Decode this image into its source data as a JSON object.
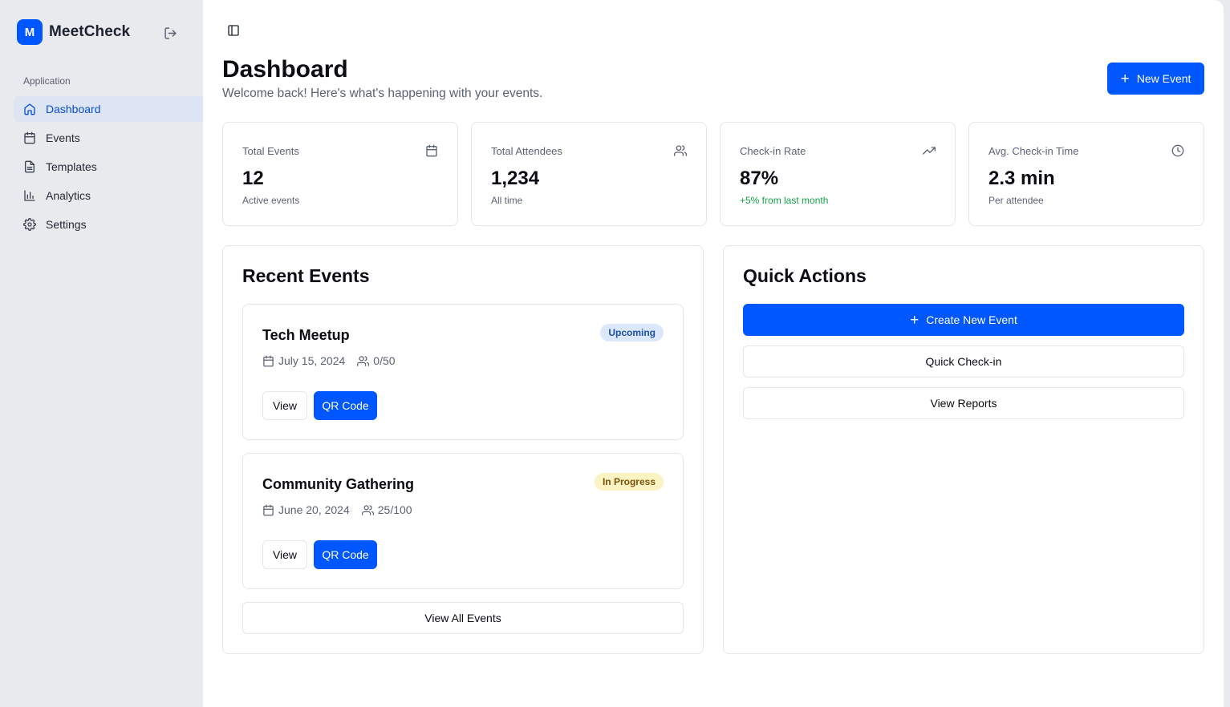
{
  "app": {
    "logo_letter": "M",
    "name": "MeetCheck"
  },
  "sidebar": {
    "section_label": "Application",
    "items": [
      {
        "label": "Dashboard",
        "icon": "home-icon",
        "active": true
      },
      {
        "label": "Events",
        "icon": "calendar-icon"
      },
      {
        "label": "Templates",
        "icon": "document-icon"
      },
      {
        "label": "Analytics",
        "icon": "bar-chart-icon"
      },
      {
        "label": "Settings",
        "icon": "gear-icon"
      }
    ]
  },
  "header": {
    "title": "Dashboard",
    "subtitle": "Welcome back! Here's what's happening with your events.",
    "new_event_label": "New Event"
  },
  "stats": [
    {
      "label": "Total Events",
      "value": "12",
      "note": "Active events",
      "icon": "calendar-icon"
    },
    {
      "label": "Total Attendees",
      "value": "1,234",
      "note": "All time",
      "icon": "users-icon"
    },
    {
      "label": "Check-in Rate",
      "value": "87%",
      "note": "+5% from last month",
      "icon": "trending-up-icon"
    },
    {
      "label": "Avg. Check-in Time",
      "value": "2.3 min",
      "note": "Per attendee",
      "icon": "clock-icon"
    }
  ],
  "recent_events": {
    "title": "Recent Events",
    "events": [
      {
        "name": "Tech Meetup",
        "status": "Upcoming",
        "date": "July 15, 2024",
        "attendees": "0/50",
        "view_label": "View",
        "qr_label": "QR Code"
      },
      {
        "name": "Community Gathering",
        "status": "In Progress",
        "date": "June 20, 2024",
        "attendees": "25/100",
        "view_label": "View",
        "qr_label": "QR Code"
      }
    ],
    "view_all_label": "View All Events"
  },
  "quick_actions": {
    "title": "Quick Actions",
    "create_label": "Create New Event",
    "checkin_label": "Quick Check-in",
    "reports_label": "View Reports"
  },
  "colors": {
    "accent": "#0057ff",
    "sidebar_bg": "#e9eaee",
    "active_bg": "#dde4f3",
    "positive": "#15a34a",
    "badge_upcoming": "#dbe7fb",
    "badge_inprogress": "#fcf3c3"
  }
}
